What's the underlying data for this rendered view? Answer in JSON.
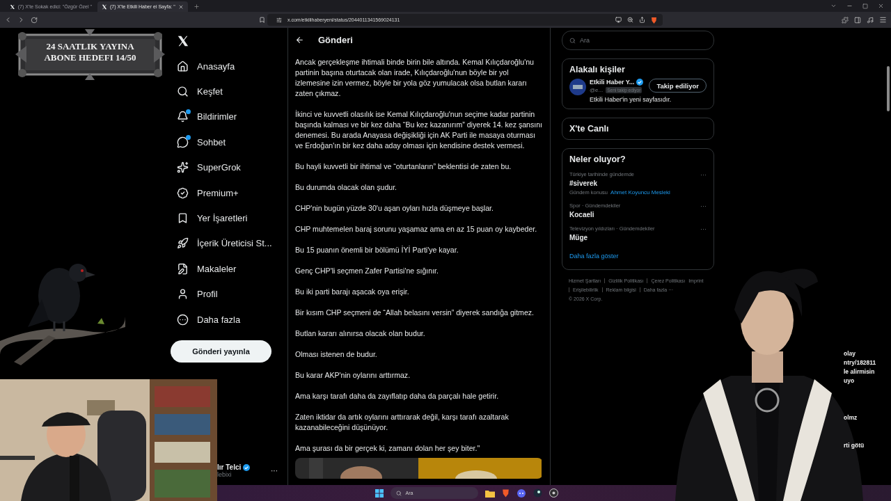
{
  "browser": {
    "tabs": [
      {
        "title": "(7) X'te Sokak edici: \"Özgür Özel \"",
        "selected": false
      },
      {
        "title": "(7) X'te Etkili Haber ei Sayfa: \"",
        "selected": true
      }
    ],
    "url": "x.com/etkilihaberyeni/status/2044011341569024131"
  },
  "overlay": {
    "goal_banner": [
      "24 SAATLIK YAYINA",
      "ABONE HEDEFI 14/50"
    ],
    "chat_fragments": [
      "olay",
      "ntry/182811",
      "le alirmisin",
      "uyo",
      "olmz",
      "rti götü"
    ]
  },
  "sidebar": {
    "items": [
      {
        "label": "Anasayfa",
        "dot": false
      },
      {
        "label": "Keşfet",
        "dot": false
      },
      {
        "label": "Bildirimler",
        "dot": true
      },
      {
        "label": "Sohbet",
        "dot": true
      },
      {
        "label": "SuperGrok",
        "dot": false
      },
      {
        "label": "Premium+",
        "dot": false
      },
      {
        "label": "Yer İşaretleri",
        "dot": false
      },
      {
        "label": "İçerik Üreticisi St...",
        "dot": false
      },
      {
        "label": "Makaleler",
        "dot": false
      },
      {
        "label": "Profil",
        "dot": false
      },
      {
        "label": "Daha fazla",
        "dot": false
      }
    ],
    "post_button": "Gönderi yayınla",
    "account": {
      "name": "lır Telci",
      "handle": "lebixi",
      "verified": true,
      "more": "···"
    }
  },
  "post": {
    "title": "Gönderi",
    "paragraphs": [
      "Ancak gerçekleşme ihtimali binde birin bile altında. Kemal Kılıçdaroğlu'nu partinin başına oturtacak olan irade, Kılıçdaroğlu'nun böyle bir yol izlemesine izin vermez, böyle bir yola göz yumulacak olsa butlan kararı zaten çıkmaz.",
      "İkinci ve kuvvetli olasılık ise Kemal Kılıçdaroğlu'nun seçime kadar partinin başında kalması ve bir kez daha “Bu kez kazanırım” diyerek 14. kez şansını denemesi. Bu arada Anayasa değişikliği için AK Parti ile masaya oturması ve Erdoğan'ın bir kez daha aday olması için kendisine destek vermesi.",
      "Bu hayli kuvvetli bir ihtimal ve “oturtanların” beklentisi de zaten bu.",
      "Bu durumda olacak olan şudur.",
      "CHP'nin bugün yüzde 30'u aşan oyları hızla düşmeye başlar.",
      "CHP muhtemelen baraj sorunu yaşamaz ama en az 15 puan oy kaybeder.",
      "Bu 15 puanın önemli bir bölümü İYİ Parti'ye kayar.",
      "Genç CHP'li seçmen Zafer Partisi'ne sığınır.",
      "Bu iki parti barajı aşacak oya erişir.",
      "Bir kısım CHP seçmeni de “Allah belasını versin” diyerek sandığa gitmez.",
      "Butlan kararı alınırsa olacak olan budur.",
      "Olması istenen de budur.",
      "Bu karar AKP'nin oylarını arttırmaz.",
      "Ama karşı tarafı daha da zayıflatıp daha da parçalı hale getirir.",
      "Zaten iktidar da artık oylarını arttırarak değil, karşı tarafı azaltarak kazanabileceğini düşünüyor.",
      "Ama şurası da bir gerçek ki, zamanı dolan her şey biter.\""
    ]
  },
  "right": {
    "search": {
      "placeholder": "Ara"
    },
    "relevant": {
      "title": "Alakalı kişiler",
      "people": [
        {
          "name": "Etkili Haber Y...",
          "handle": "@e...",
          "follows_you": "Seni takip ediyor",
          "verified": true,
          "button": "Takip ediliyor",
          "bio": "Etkili Haber'in yeni sayfasıdır."
        }
      ]
    },
    "live": {
      "title": "X'te Canlı"
    },
    "trends": {
      "title": "Neler oluyor?",
      "items": [
        {
          "context": "Türkiye tarihinde gündemde",
          "title": "#siverek",
          "topic_label": "Gündem konusu",
          "topic_link": "Ahmet Koyuncu Mesleki",
          "more": "···"
        },
        {
          "context": "Spor · Gündemdekiler",
          "title": "Kocaeli",
          "more": "···"
        },
        {
          "context": "Televizyon yıldızları · Gündemdekiler",
          "title": "Müge",
          "more": "···"
        }
      ],
      "more": "Daha fazla göster"
    },
    "footer": [
      "Hizmet Şartları",
      "Gizlilik Politikası",
      "Çerez Politikası",
      "Imprint",
      "Erişilebilirlik",
      "Reklam bilgisi",
      "Daha fazla ···",
      "© 2026 X Corp."
    ]
  },
  "taskbar": {
    "search": {
      "placeholder": "Ara"
    }
  }
}
